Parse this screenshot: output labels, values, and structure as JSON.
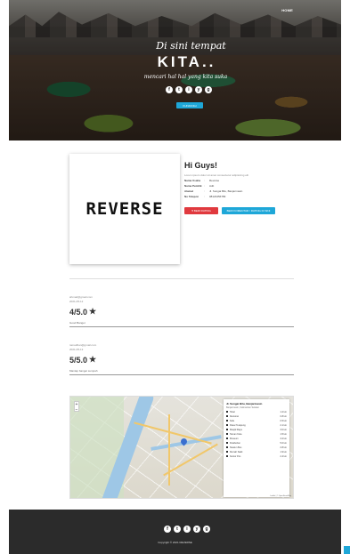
{
  "nav": {
    "link": "HOME"
  },
  "hero": {
    "line1": "Di sini tempat",
    "line2": "KITA..",
    "line3": "mencari hal hal yang kita suka",
    "cta": "KUNJUNGI",
    "socials": [
      "f",
      "t",
      "i",
      "y",
      "g"
    ]
  },
  "profile": {
    "logo": "REVERSE",
    "heading": "Hi Guys!",
    "intro": "Lorem ipsum dolor sit amet consectetur adipisicing elit",
    "fields": [
      {
        "key": "Nama Usaha",
        "sep": ":",
        "value": "Reverse"
      },
      {
        "key": "Nama Pemilik",
        "sep": ":",
        "value": "Adit"
      },
      {
        "key": "Alamat",
        "sep": ":",
        "value": "Jl. Sungai Bilu, Banjarmasin"
      },
      {
        "key": "No Telepon",
        "sep": ":",
        "value": "08123456789"
      }
    ],
    "btn_like": "♥ BERI RATING",
    "btn_contact": "BERI KOMENTAR / RATING DI SINI"
  },
  "reviews": [
    {
      "email": "ahmad@gmail.com",
      "date": "2021-05-12",
      "rating": "4/5.0",
      "comment": "Good Banget"
    },
    {
      "email": "ramadhan@gmail.com",
      "date": "2021-05-13",
      "rating": "5/5.0",
      "comment": "Mantap banget sumpah"
    }
  ],
  "map": {
    "zoom_in": "+",
    "zoom_out": "−",
    "panel_title": "Jl. Sungai Bilu, Banjarmasin",
    "panel_sub": "Banjarmasin, Kalimantan Selatan",
    "rows": [
      {
        "label": "Hotel",
        "value": "1.2 km"
      },
      {
        "label": "Restoran",
        "value": "0.8 km"
      },
      {
        "label": "Kafe",
        "value": "0.5 km"
      },
      {
        "label": "Pasar Terapung",
        "value": "2.1 km"
      },
      {
        "label": "Masjid Raya",
        "value": "3.0 km"
      },
      {
        "label": "Taman Kota",
        "value": "1.5 km"
      },
      {
        "label": "Museum",
        "value": "4.2 km"
      },
      {
        "label": "Pelabuhan",
        "value": "5.0 km"
      },
      {
        "label": "Stasiun Bus",
        "value": "2.8 km"
      },
      {
        "label": "Rumah Sakit",
        "value": "1.9 km"
      },
      {
        "label": "Kantor Pos",
        "value": "2.4 km"
      }
    ],
    "attrib": "Leaflet | © OpenStreetMap"
  },
  "footer": {
    "socials": [
      "f",
      "t",
      "i",
      "y",
      "g"
    ],
    "copy": "Copyright © 2021 REVERSE"
  }
}
